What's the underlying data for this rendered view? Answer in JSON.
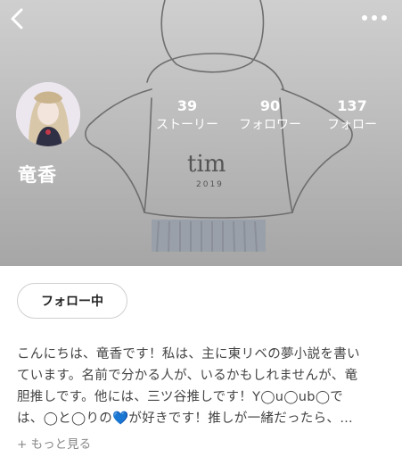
{
  "profile": {
    "username": "竜香",
    "stats": [
      {
        "value": "39",
        "label": "ストーリー"
      },
      {
        "value": "90",
        "label": "フォロワー"
      },
      {
        "value": "137",
        "label": "フォロー"
      }
    ],
    "follow_button": "フォロー中",
    "bio_lines": [
      "こんにちは、竜香です！私は、主に東リベの夢小説を書い",
      "ています。名前で分かる人が、いるかもしれませんが、竜",
      "胆推しです。他には、三ツ谷推しです！Y◯u◯ub◯で",
      "は、◯と◯りの💙が好きです！推しが一緒だったら、…"
    ],
    "see_more": "+ もっと見る"
  },
  "cover_text": {
    "brand": "tim",
    "year": "2019"
  },
  "icons": {
    "back": "chevron-left-icon",
    "more": "more-horizontal-icon"
  }
}
